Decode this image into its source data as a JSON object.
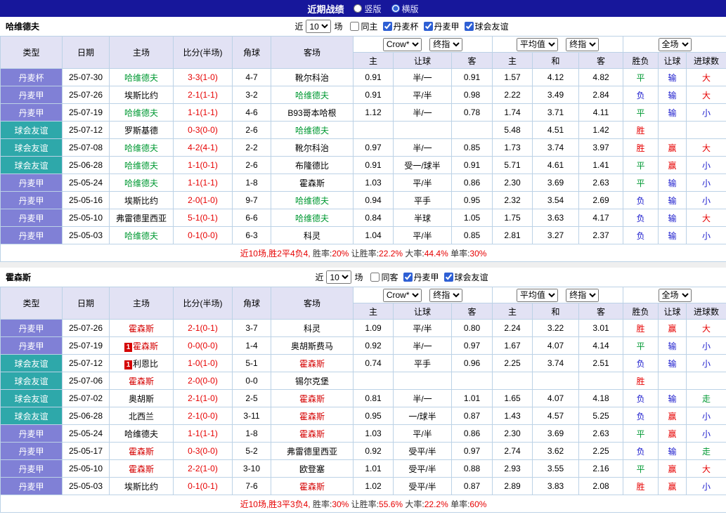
{
  "topbar": {
    "title": "近期战绩",
    "radio_vertical": "竖版",
    "radio_horizontal": "横版"
  },
  "palette": {
    "league": {
      "purple": "#8080d6",
      "teal": "#2ea8aa"
    },
    "result": {
      "red": "#e60000",
      "green": "#009933",
      "blue": "#1a1acd"
    },
    "text": {
      "red": "#e60000",
      "black": "#333333"
    }
  },
  "sections": [
    {
      "team": "哈维德夫",
      "focus_color": "#009933",
      "filter": {
        "near_label": "近",
        "count": "10",
        "games_label": "场",
        "checkboxes": [
          {
            "label": "同主",
            "checked": false
          },
          {
            "label": "丹麦杯",
            "checked": true
          },
          {
            "label": "丹麦甲",
            "checked": true
          },
          {
            "label": "球会友谊",
            "checked": true
          }
        ]
      },
      "header": {
        "cols": [
          "类型",
          "日期",
          "主场",
          "比分(半场)",
          "角球",
          "客场"
        ],
        "odds1_dd1": "Crow*",
        "odds1_dd2": "终指",
        "odds2_dd1": "平均值",
        "odds2_dd2": "终指",
        "odds3_dd": "全场",
        "sub": [
          "主",
          "让球",
          "客",
          "主",
          "和",
          "客",
          "胜负",
          "让球",
          "进球数"
        ]
      },
      "rows": [
        {
          "league": "丹麦杯",
          "lt": "purple",
          "date": "25-07-30",
          "home": "哈维德夫",
          "hf": true,
          "score": "3-3(1-0)",
          "corner": "4-7",
          "away": "靴尔科治",
          "af": false,
          "ah": "0.91",
          "hc": "半/一",
          "aa": "0.91",
          "mh": "1.57",
          "md": "4.12",
          "ma": "4.82",
          "r1": "平",
          "r1c": "green",
          "r2": "输",
          "r2c": "blue",
          "r3": "大",
          "r3c": "red"
        },
        {
          "league": "丹麦甲",
          "lt": "purple",
          "date": "25-07-26",
          "home": "埃斯比约",
          "hf": false,
          "score": "2-1(1-1)",
          "corner": "3-2",
          "away": "哈维德夫",
          "af": true,
          "ah": "0.91",
          "hc": "平/半",
          "aa": "0.98",
          "mh": "2.22",
          "md": "3.49",
          "ma": "2.84",
          "r1": "负",
          "r1c": "blue",
          "r2": "输",
          "r2c": "blue",
          "r3": "大",
          "r3c": "red"
        },
        {
          "league": "丹麦甲",
          "lt": "purple",
          "date": "25-07-19",
          "home": "哈维德夫",
          "hf": true,
          "score": "1-1(1-1)",
          "corner": "4-6",
          "away": "B93哥本哈根",
          "af": false,
          "ah": "1.12",
          "hc": "半/一",
          "aa": "0.78",
          "mh": "1.74",
          "md": "3.71",
          "ma": "4.11",
          "r1": "平",
          "r1c": "green",
          "r2": "输",
          "r2c": "blue",
          "r3": "小",
          "r3c": "blue"
        },
        {
          "league": "球会友谊",
          "lt": "teal",
          "date": "25-07-12",
          "home": "罗斯基德",
          "hf": false,
          "score": "0-3(0-0)",
          "corner": "2-6",
          "away": "哈维德夫",
          "af": true,
          "ah": "",
          "hc": "",
          "aa": "",
          "mh": "5.48",
          "md": "4.51",
          "ma": "1.42",
          "r1": "胜",
          "r1c": "red",
          "r2": "",
          "r2c": "",
          "r3": "",
          "r3c": ""
        },
        {
          "league": "球会友谊",
          "lt": "teal",
          "date": "25-07-08",
          "home": "哈维德夫",
          "hf": true,
          "score": "4-2(4-1)",
          "corner": "2-2",
          "away": "靴尔科治",
          "af": false,
          "ah": "0.97",
          "hc": "半/一",
          "aa": "0.85",
          "mh": "1.73",
          "md": "3.74",
          "ma": "3.97",
          "r1": "胜",
          "r1c": "red",
          "r2": "赢",
          "r2c": "red",
          "r3": "大",
          "r3c": "red"
        },
        {
          "league": "球会友谊",
          "lt": "teal",
          "date": "25-06-28",
          "home": "哈维德夫",
          "hf": true,
          "score": "1-1(0-1)",
          "corner": "2-6",
          "away": "布隆德比",
          "af": false,
          "ah": "0.91",
          "hc": "受一/球半",
          "aa": "0.91",
          "mh": "5.71",
          "md": "4.61",
          "ma": "1.41",
          "r1": "平",
          "r1c": "green",
          "r2": "赢",
          "r2c": "red",
          "r3": "小",
          "r3c": "blue"
        },
        {
          "league": "丹麦甲",
          "lt": "purple",
          "date": "25-05-24",
          "home": "哈维德夫",
          "hf": true,
          "score": "1-1(1-1)",
          "corner": "1-8",
          "away": "霍森斯",
          "af": false,
          "ah": "1.03",
          "hc": "平/半",
          "aa": "0.86",
          "mh": "2.30",
          "md": "3.69",
          "ma": "2.63",
          "r1": "平",
          "r1c": "green",
          "r2": "输",
          "r2c": "blue",
          "r3": "小",
          "r3c": "blue"
        },
        {
          "league": "丹麦甲",
          "lt": "purple",
          "date": "25-05-16",
          "home": "埃斯比约",
          "hf": false,
          "score": "2-0(1-0)",
          "corner": "9-7",
          "away": "哈维德夫",
          "af": true,
          "ah": "0.94",
          "hc": "平手",
          "aa": "0.95",
          "mh": "2.32",
          "md": "3.54",
          "ma": "2.69",
          "r1": "负",
          "r1c": "blue",
          "r2": "输",
          "r2c": "blue",
          "r3": "小",
          "r3c": "blue"
        },
        {
          "league": "丹麦甲",
          "lt": "purple",
          "date": "25-05-10",
          "home": "弗雷德里西亚",
          "hf": false,
          "score": "5-1(0-1)",
          "corner": "6-6",
          "away": "哈维德夫",
          "af": true,
          "ah": "0.84",
          "hc": "半球",
          "aa": "1.05",
          "mh": "1.75",
          "md": "3.63",
          "ma": "4.17",
          "r1": "负",
          "r1c": "blue",
          "r2": "输",
          "r2c": "blue",
          "r3": "大",
          "r3c": "red"
        },
        {
          "league": "丹麦甲",
          "lt": "purple",
          "date": "25-05-03",
          "home": "哈维德夫",
          "hf": true,
          "score": "0-1(0-0)",
          "corner": "6-3",
          "away": "科灵",
          "af": false,
          "ah": "1.04",
          "hc": "平/半",
          "aa": "0.85",
          "mh": "2.81",
          "md": "3.27",
          "ma": "2.37",
          "r1": "负",
          "r1c": "blue",
          "r2": "输",
          "r2c": "blue",
          "r3": "小",
          "r3c": "blue"
        }
      ],
      "footer": [
        {
          "t": "近10场,胜2平4负4, ",
          "c": "red"
        },
        {
          "t": "胜率:",
          "c": "black"
        },
        {
          "t": "20%",
          "c": "red"
        },
        {
          "t": " 让胜率:",
          "c": "black"
        },
        {
          "t": "22.2%",
          "c": "red"
        },
        {
          "t": " 大率:",
          "c": "black"
        },
        {
          "t": "44.4%",
          "c": "red"
        },
        {
          "t": " 单率:",
          "c": "black"
        },
        {
          "t": "30%",
          "c": "red"
        }
      ]
    },
    {
      "team": "霍森斯",
      "focus_color": "#d40000",
      "filter": {
        "near_label": "近",
        "count": "10",
        "games_label": "场",
        "checkboxes": [
          {
            "label": "同客",
            "checked": false
          },
          {
            "label": "丹麦甲",
            "checked": true
          },
          {
            "label": "球会友谊",
            "checked": true
          }
        ]
      },
      "header": {
        "cols": [
          "类型",
          "日期",
          "主场",
          "比分(半场)",
          "角球",
          "客场"
        ],
        "odds1_dd1": "Crow*",
        "odds1_dd2": "终指",
        "odds2_dd1": "平均值",
        "odds2_dd2": "终指",
        "odds3_dd": "全场",
        "sub": [
          "主",
          "让球",
          "客",
          "主",
          "和",
          "客",
          "胜负",
          "让球",
          "进球数"
        ]
      },
      "rows": [
        {
          "league": "丹麦甲",
          "lt": "purple",
          "date": "25-07-26",
          "home": "霍森斯",
          "hf": true,
          "score": "2-1(0-1)",
          "corner": "3-7",
          "away": "科灵",
          "af": false,
          "ah": "1.09",
          "hc": "平/半",
          "aa": "0.80",
          "mh": "2.24",
          "md": "3.22",
          "ma": "3.01",
          "r1": "胜",
          "r1c": "red",
          "r2": "赢",
          "r2c": "red",
          "r3": "大",
          "r3c": "red"
        },
        {
          "league": "丹麦甲",
          "lt": "purple",
          "date": "25-07-19",
          "home": "霍森斯",
          "hf": true,
          "hb": "1",
          "score": "0-0(0-0)",
          "corner": "1-4",
          "away": "奥胡斯费马",
          "af": false,
          "ah": "0.92",
          "hc": "半/一",
          "aa": "0.97",
          "mh": "1.67",
          "md": "4.07",
          "ma": "4.14",
          "r1": "平",
          "r1c": "green",
          "r2": "输",
          "r2c": "blue",
          "r3": "小",
          "r3c": "blue"
        },
        {
          "league": "球会友谊",
          "lt": "teal",
          "date": "25-07-12",
          "home": "利恩比",
          "hf": false,
          "hb": "1",
          "score": "1-0(1-0)",
          "corner": "5-1",
          "away": "霍森斯",
          "af": true,
          "ah": "0.74",
          "hc": "平手",
          "aa": "0.96",
          "mh": "2.25",
          "md": "3.74",
          "ma": "2.51",
          "r1": "负",
          "r1c": "blue",
          "r2": "输",
          "r2c": "blue",
          "r3": "小",
          "r3c": "blue"
        },
        {
          "league": "球会友谊",
          "lt": "teal",
          "date": "25-07-06",
          "home": "霍森斯",
          "hf": true,
          "score": "2-0(0-0)",
          "corner": "0-0",
          "away": "锡尔克堡",
          "af": false,
          "ah": "",
          "hc": "",
          "aa": "",
          "mh": "",
          "md": "",
          "ma": "",
          "r1": "胜",
          "r1c": "red",
          "r2": "",
          "r2c": "",
          "r3": "",
          "r3c": ""
        },
        {
          "league": "球会友谊",
          "lt": "teal",
          "date": "25-07-02",
          "home": "奥胡斯",
          "hf": false,
          "score": "2-1(1-0)",
          "corner": "2-5",
          "away": "霍森斯",
          "af": true,
          "ah": "0.81",
          "hc": "半/一",
          "aa": "1.01",
          "mh": "1.65",
          "md": "4.07",
          "ma": "4.18",
          "r1": "负",
          "r1c": "blue",
          "r2": "输",
          "r2c": "blue",
          "r3": "走",
          "r3c": "green"
        },
        {
          "league": "球会友谊",
          "lt": "teal",
          "date": "25-06-28",
          "home": "北西兰",
          "hf": false,
          "score": "2-1(0-0)",
          "corner": "3-11",
          "away": "霍森斯",
          "af": true,
          "ah": "0.95",
          "hc": "一/球半",
          "aa": "0.87",
          "mh": "1.43",
          "md": "4.57",
          "ma": "5.25",
          "r1": "负",
          "r1c": "blue",
          "r2": "赢",
          "r2c": "red",
          "r3": "小",
          "r3c": "blue"
        },
        {
          "league": "丹麦甲",
          "lt": "purple",
          "date": "25-05-24",
          "home": "哈维德夫",
          "hf": false,
          "score": "1-1(1-1)",
          "corner": "1-8",
          "away": "霍森斯",
          "af": true,
          "ah": "1.03",
          "hc": "平/半",
          "aa": "0.86",
          "mh": "2.30",
          "md": "3.69",
          "ma": "2.63",
          "r1": "平",
          "r1c": "green",
          "r2": "赢",
          "r2c": "red",
          "r3": "小",
          "r3c": "blue"
        },
        {
          "league": "丹麦甲",
          "lt": "purple",
          "date": "25-05-17",
          "home": "霍森斯",
          "hf": true,
          "score": "0-3(0-0)",
          "corner": "5-2",
          "away": "弗雷德里西亚",
          "af": false,
          "ah": "0.92",
          "hc": "受平/半",
          "aa": "0.97",
          "mh": "2.74",
          "md": "3.62",
          "ma": "2.25",
          "r1": "负",
          "r1c": "blue",
          "r2": "输",
          "r2c": "blue",
          "r3": "走",
          "r3c": "green"
        },
        {
          "league": "丹麦甲",
          "lt": "purple",
          "date": "25-05-10",
          "home": "霍森斯",
          "hf": true,
          "score": "2-2(1-0)",
          "corner": "3-10",
          "away": "欧登塞",
          "af": false,
          "ah": "1.01",
          "hc": "受平/半",
          "aa": "0.88",
          "mh": "2.93",
          "md": "3.55",
          "ma": "2.16",
          "r1": "平",
          "r1c": "green",
          "r2": "赢",
          "r2c": "red",
          "r3": "大",
          "r3c": "red"
        },
        {
          "league": "丹麦甲",
          "lt": "purple",
          "date": "25-05-03",
          "home": "埃斯比约",
          "hf": false,
          "score": "0-1(0-1)",
          "corner": "7-6",
          "away": "霍森斯",
          "af": true,
          "ah": "1.02",
          "hc": "受平/半",
          "aa": "0.87",
          "mh": "2.89",
          "md": "3.83",
          "ma": "2.08",
          "r1": "胜",
          "r1c": "red",
          "r2": "赢",
          "r2c": "red",
          "r3": "小",
          "r3c": "blue"
        }
      ],
      "footer": [
        {
          "t": "近10场,胜3平3负4, ",
          "c": "red"
        },
        {
          "t": "胜率:",
          "c": "black"
        },
        {
          "t": "30%",
          "c": "red"
        },
        {
          "t": " 让胜率:",
          "c": "black"
        },
        {
          "t": "55.6%",
          "c": "red"
        },
        {
          "t": " 大率:",
          "c": "black"
        },
        {
          "t": "22.2%",
          "c": "red"
        },
        {
          "t": " 单率:",
          "c": "black"
        },
        {
          "t": "60%",
          "c": "red"
        }
      ]
    }
  ]
}
